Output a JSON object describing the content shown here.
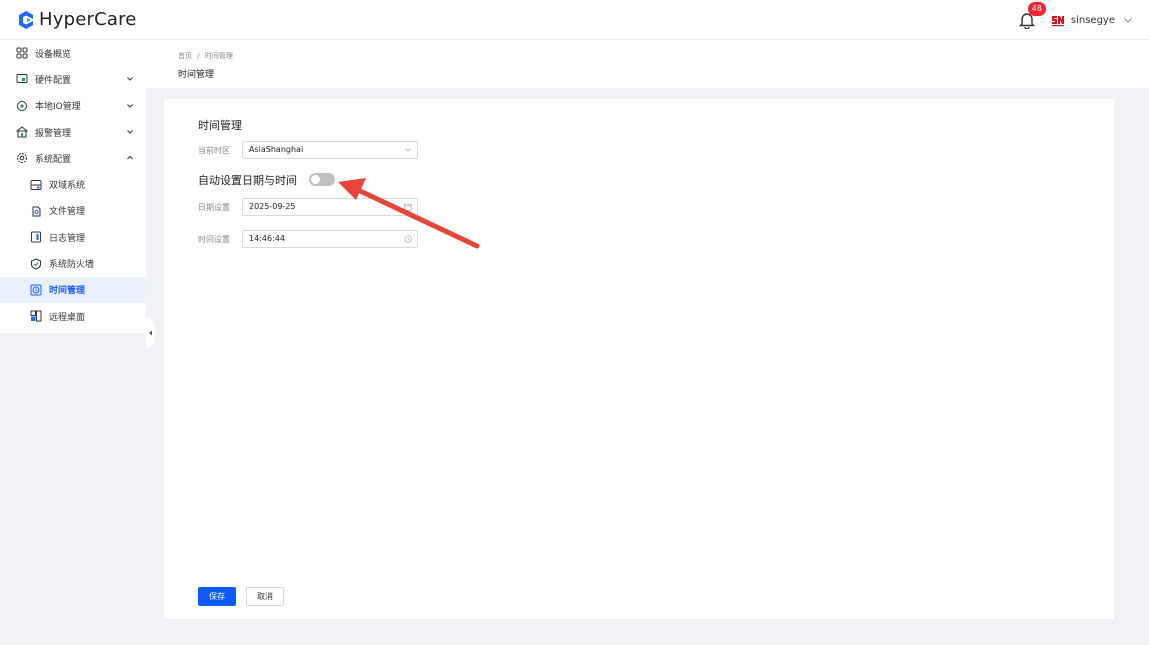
{
  "header": {
    "app_name": "HyperCare",
    "notification_count": "48",
    "username": "sinsegye"
  },
  "sidebar": {
    "items": [
      {
        "label": "设备概览",
        "icon": "grid-icon"
      },
      {
        "label": "硬件配置",
        "icon": "hardware-icon"
      },
      {
        "label": "本地IO管理",
        "icon": "io-icon"
      },
      {
        "label": "报警管理",
        "icon": "alarm-icon"
      },
      {
        "label": "系统配置",
        "icon": "system-config-icon"
      },
      {
        "label": "双域系统",
        "icon": "dual-domain-icon"
      },
      {
        "label": "文件管理",
        "icon": "file-icon"
      },
      {
        "label": "日志管理",
        "icon": "log-icon"
      },
      {
        "label": "系统防火墙",
        "icon": "firewall-icon"
      },
      {
        "label": "时间管理",
        "icon": "clock-icon"
      },
      {
        "label": "远程桌面",
        "icon": "remote-desktop-icon"
      }
    ]
  },
  "breadcrumb": {
    "home": "首页",
    "sep": "/",
    "current": "时间管理"
  },
  "page_title": "时间管理",
  "form": {
    "title": "时间管理",
    "timezone_label": "当前时区",
    "timezone_value": "AsiaShanghai",
    "auto_label": "自动设置日期与时间",
    "auto_enabled": false,
    "date_label": "日期设置",
    "date_value": "2025-09-25",
    "time_label": "时间设置",
    "time_value": "14:46:44"
  },
  "buttons": {
    "save": "保存",
    "cancel": "取消"
  },
  "colors": {
    "primary": "#0d5bff",
    "badge": "#f5222d",
    "arrow": "#e8443a",
    "active_bg": "#e9f0ff"
  }
}
